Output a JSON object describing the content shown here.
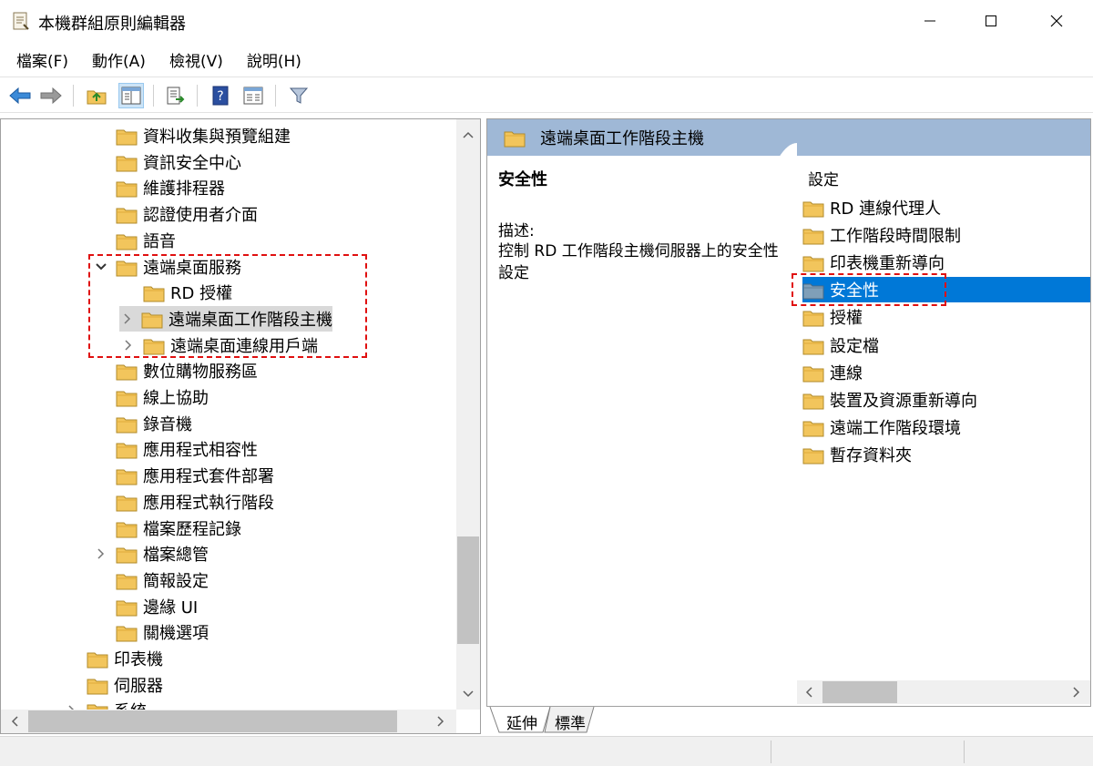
{
  "window": {
    "title": "本機群組原則編輯器",
    "min_glyph": "—",
    "max_glyph": "☐",
    "close_glyph": "✕"
  },
  "menu": [
    "檔案(F)",
    "動作(A)",
    "檢視(V)",
    "說明(H)"
  ],
  "toolbar": {
    "buttons": [
      "back-icon",
      "forward-icon",
      "up-folder-icon",
      "show-hide-tree-icon",
      "export-list-icon",
      "help-icon",
      "view-icon",
      "filter-icon"
    ]
  },
  "tree": {
    "items": [
      {
        "label": "資料收集與預覽組建",
        "level": 1,
        "expander": ""
      },
      {
        "label": "資訊安全中心",
        "level": 1,
        "expander": ""
      },
      {
        "label": "維護排程器",
        "level": 1,
        "expander": ""
      },
      {
        "label": "認證使用者介面",
        "level": 1,
        "expander": ""
      },
      {
        "label": "語音",
        "level": 1,
        "expander": ""
      },
      {
        "label": "遠端桌面服務",
        "level": 1,
        "expander": "expanded"
      },
      {
        "label": "RD 授權",
        "level": 2,
        "expander": ""
      },
      {
        "label": "遠端桌面工作階段主機",
        "level": 2,
        "expander": "collapsed",
        "selected": true
      },
      {
        "label": "遠端桌面連線用戶端",
        "level": 2,
        "expander": "collapsed"
      },
      {
        "label": "數位購物服務區",
        "level": 1,
        "expander": ""
      },
      {
        "label": "線上協助",
        "level": 1,
        "expander": ""
      },
      {
        "label": "錄音機",
        "level": 1,
        "expander": ""
      },
      {
        "label": "應用程式相容性",
        "level": 1,
        "expander": ""
      },
      {
        "label": "應用程式套件部署",
        "level": 1,
        "expander": ""
      },
      {
        "label": "應用程式執行階段",
        "level": 1,
        "expander": ""
      },
      {
        "label": "檔案歷程記錄",
        "level": 1,
        "expander": ""
      },
      {
        "label": "檔案總管",
        "level": 1,
        "expander": "collapsed"
      },
      {
        "label": "簡報設定",
        "level": 1,
        "expander": ""
      },
      {
        "label": "邊緣 UI",
        "level": 1,
        "expander": ""
      },
      {
        "label": "關機選項",
        "level": 1,
        "expander": ""
      },
      {
        "label": "印表機",
        "level": 0,
        "expander": ""
      },
      {
        "label": "伺服器",
        "level": 0,
        "expander": ""
      },
      {
        "label": "系統",
        "level": 0,
        "expander": "collapsed"
      }
    ]
  },
  "right": {
    "header": "遠端桌面工作階段主機",
    "detail_title": "安全性",
    "desc_label": "描述:",
    "desc_text": "控制 RD 工作階段主機伺服器上的安全性設定",
    "column_header": "設定",
    "items": [
      {
        "label": "RD 連線代理人"
      },
      {
        "label": "工作階段時間限制"
      },
      {
        "label": "印表機重新導向"
      },
      {
        "label": "安全性",
        "selected": true
      },
      {
        "label": "授權"
      },
      {
        "label": "設定檔"
      },
      {
        "label": "連線"
      },
      {
        "label": "裝置及資源重新導向"
      },
      {
        "label": "遠端工作階段環境"
      },
      {
        "label": "暫存資料夾"
      }
    ]
  },
  "tabs": [
    "延伸",
    "標準"
  ],
  "colors": {
    "selection": "#0078d7",
    "header_band": "#9fb8d6",
    "annotation": "#e01010",
    "folder": "#f2c55c"
  }
}
